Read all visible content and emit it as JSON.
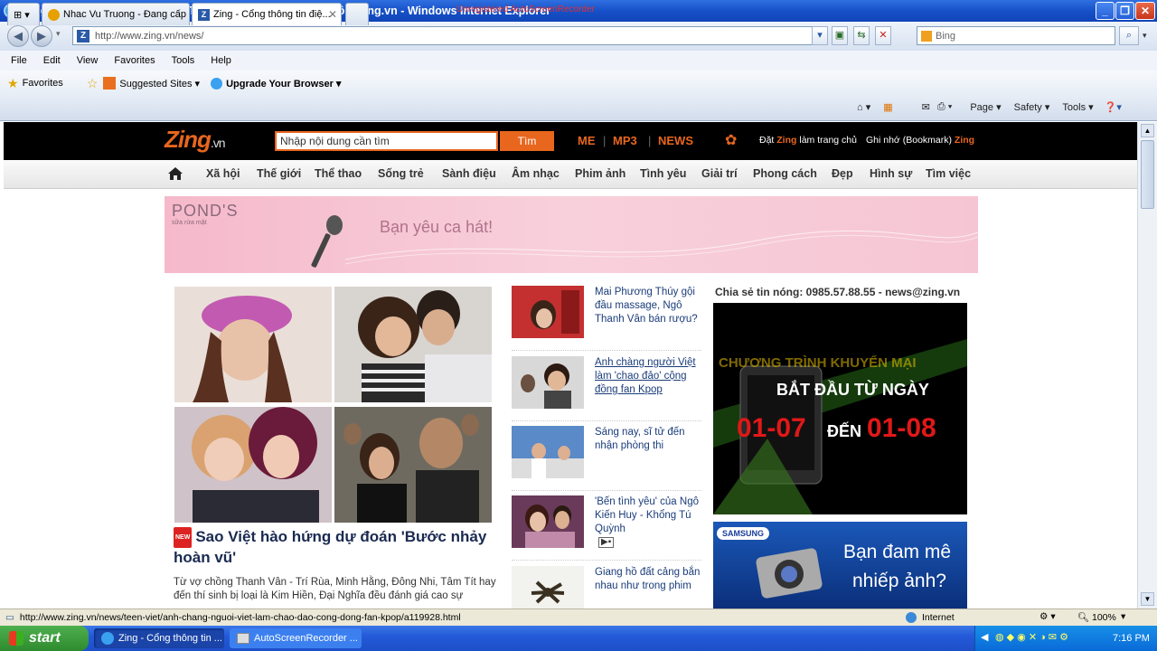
{
  "window": {
    "title": "Zing - Cong thông tin điện tư | Tin tưc - Giai trí - Mang xã hôi | Zing.vn - Windows Internet Explorer",
    "title_overlay": "Unregistered AutoScreenRecorder"
  },
  "nav": {
    "url": "http://www.zing.vn/news/",
    "search_placeholder": "Bing"
  },
  "menu": [
    "File",
    "Edit",
    "View",
    "Favorites",
    "Tools",
    "Help"
  ],
  "favorites_bar": {
    "favorites": "Favorites",
    "suggested": "Suggested Sites ▾",
    "upgrade": "Upgrade Your Browser ▾"
  },
  "tabs": [
    {
      "label": "Nhac Vu Truong - Đang cấp ..."
    },
    {
      "label": "Zing - Cổng thông tin điệ..."
    }
  ],
  "command_bar": {
    "page": "Page ▾",
    "safety": "Safety ▾",
    "tools": "Tools ▾"
  },
  "zing": {
    "logo": "Zing",
    "logo_suffix": ".vn",
    "search_placeholder": "Nhập nội dung cần tìm",
    "search_button": "Tìm",
    "links": [
      "ME",
      "MP3",
      "NEWS"
    ],
    "set_home_prefix": "Đặt ",
    "set_home_brand": "Zing",
    "set_home_suffix": " làm trang chủ",
    "bookmark_prefix": "Ghi nhớ (Bookmark) ",
    "bookmark_brand": "Zing",
    "categories": [
      "Xã hội",
      "Thế giới",
      "Thể thao",
      "Sống trẻ",
      "Sành điệu",
      "Âm nhạc",
      "Phim ảnh",
      "Tình yêu",
      "Giải trí",
      "Phong cách",
      "Đẹp",
      "Hình sự",
      "Tìm việc"
    ]
  },
  "banner": {
    "brand": "POND'S",
    "brand_sub": "sữa rửa mặt",
    "text": "Bạn yêu ca hát!"
  },
  "main_story": {
    "badge": "NEW",
    "headline": "Sao Việt hào hứng dự đoán 'Bước nhảy hoàn vũ'",
    "summary": "Từ vợ chồng Thanh Vân - Trí Rùa, Minh Hằng, Đông Nhi, Tâm Tít hay đến thí sinh bị loại là Kim Hiền, Đại Nghĩa đều đánh giá cao sự"
  },
  "news": [
    {
      "title": "Mai Phương Thúy gội đầu massage, Ngô Thanh Vân bán rượu?"
    },
    {
      "title": "Anh chàng người Việt làm 'chao đảo' cộng đồng fan Kpop"
    },
    {
      "title": "Sáng nay, sĩ tử đến nhận phòng thi"
    },
    {
      "title": "'Bến tình yêu' của Ngô Kiến Huy - Khổng Tú Quỳnh"
    },
    {
      "title": "Giang hồ đất cảng bắn nhau như trong phim"
    }
  ],
  "sidebar": {
    "hotline": "Chia sẻ tin nóng: 0985.57.88.55 - news@zing.vn",
    "ad1_top": "CHƯƠNG TRÌNH KHUYẾN MẠI",
    "ad1_line2": "BẮT ĐẦU TỪ NGÀY",
    "ad1_from": "01-07",
    "ad1_to_word": "ĐẾN",
    "ad1_to": "01-08",
    "ad2_brand": "SAMSUNG",
    "ad2_line1": "Bạn đam mê",
    "ad2_line2": "nhiếp ảnh?"
  },
  "status": {
    "url": "http://www.zing.vn/news/teen-viet/anh-chang-nguoi-viet-lam-chao-dao-cong-dong-fan-kpop/a119928.html",
    "zone": "Internet",
    "zoom": "100%"
  },
  "taskbar": {
    "start": "start",
    "items": [
      "Zing - Cổng thông tin ...",
      "AutoScreenRecorder ..."
    ],
    "clock": "7:16 PM"
  },
  "colors": {
    "zing_orange": "#e8661e",
    "link_blue": "#1a3c7a"
  }
}
